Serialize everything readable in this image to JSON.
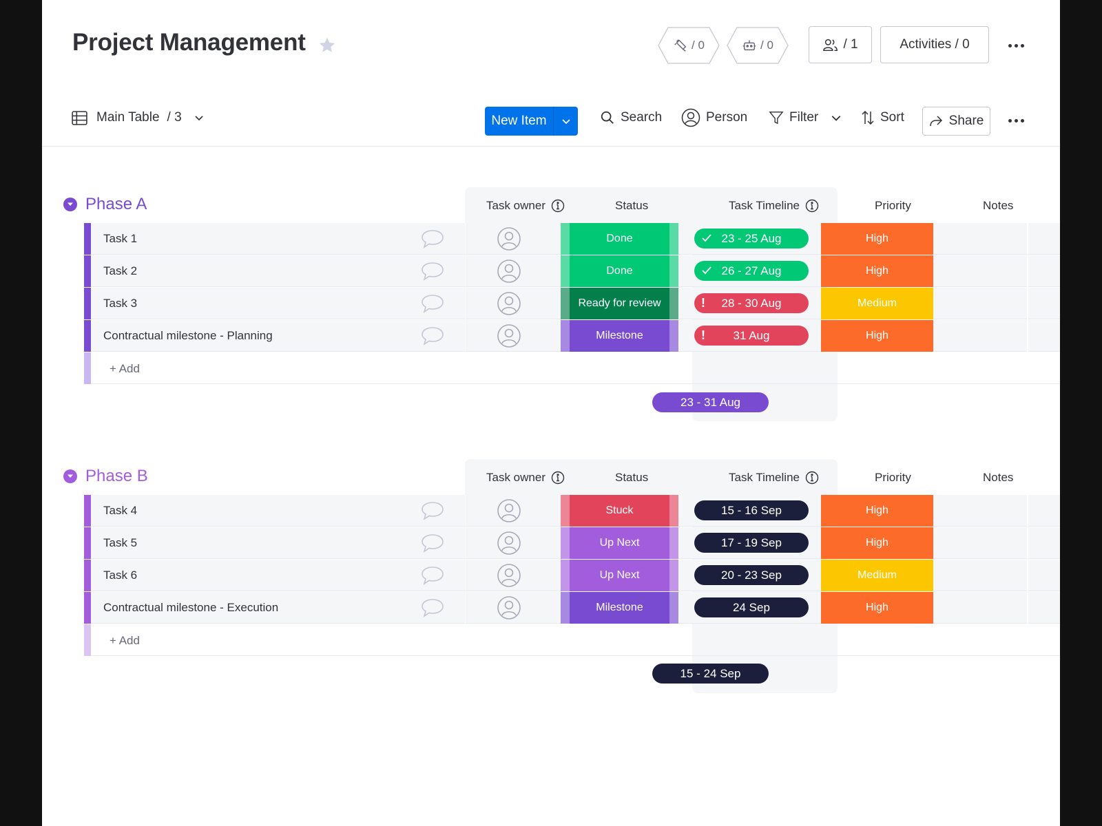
{
  "header": {
    "title": "Project Management",
    "integrations_count": "/ 0",
    "automations_count": "/ 0",
    "members_count": "/ 1",
    "activities_label": "Activities / 0"
  },
  "toolbar": {
    "view_label": "Main Table",
    "view_count": "/ 3",
    "new_item_label": "New Item",
    "search_label": "Search",
    "person_label": "Person",
    "filter_label": "Filter",
    "sort_label": "Sort",
    "share_label": "Share"
  },
  "columns": {
    "owner": "Task owner",
    "status": "Status",
    "timeline": "Task Timeline",
    "priority": "Priority",
    "notes": "Notes"
  },
  "add_label": "+ Add",
  "colors": {
    "accent": "#0073ea",
    "phase_a": "#784bd1",
    "phase_b": "#a25ddc",
    "done": "#00c875",
    "ready_for_review": "#037f4c",
    "milestone": "#784bd1",
    "stuck": "#e2445c",
    "up_next": "#a25ddc",
    "high": "#fd6b2b",
    "medium": "#fdc700",
    "timeline_dark": "#1c1f3b"
  },
  "groups": [
    {
      "title": "Phase A",
      "summary_timeline": "23 - 31 Aug",
      "rows": [
        {
          "name": "Task 1",
          "status": "Done",
          "timeline": "23 - 25 Aug",
          "timeline_icon": "check-icon",
          "priority": "High"
        },
        {
          "name": "Task 2",
          "status": "Done",
          "timeline": "26 - 27 Aug",
          "timeline_icon": "check-icon",
          "priority": "High"
        },
        {
          "name": "Task 3",
          "status": "Ready for review",
          "timeline": "28 - 30 Aug",
          "timeline_icon": "warning-icon",
          "priority": "Medium"
        },
        {
          "name": "Contractual milestone - Planning",
          "status": "Milestone",
          "timeline": "31 Aug",
          "timeline_icon": "warning-icon",
          "priority": "High"
        }
      ]
    },
    {
      "title": "Phase B",
      "summary_timeline": "15 - 24 Sep",
      "rows": [
        {
          "name": "Task 4",
          "status": "Stuck",
          "timeline": "15 - 16 Sep",
          "priority": "High"
        },
        {
          "name": "Task 5",
          "status": "Up Next",
          "timeline": "17 - 19 Sep",
          "priority": "High"
        },
        {
          "name": "Task 6",
          "status": "Up Next",
          "timeline": "20 - 23 Sep",
          "priority": "Medium"
        },
        {
          "name": "Contractual milestone - Execution",
          "status": "Milestone",
          "timeline": "24 Sep",
          "priority": "High"
        }
      ]
    }
  ]
}
